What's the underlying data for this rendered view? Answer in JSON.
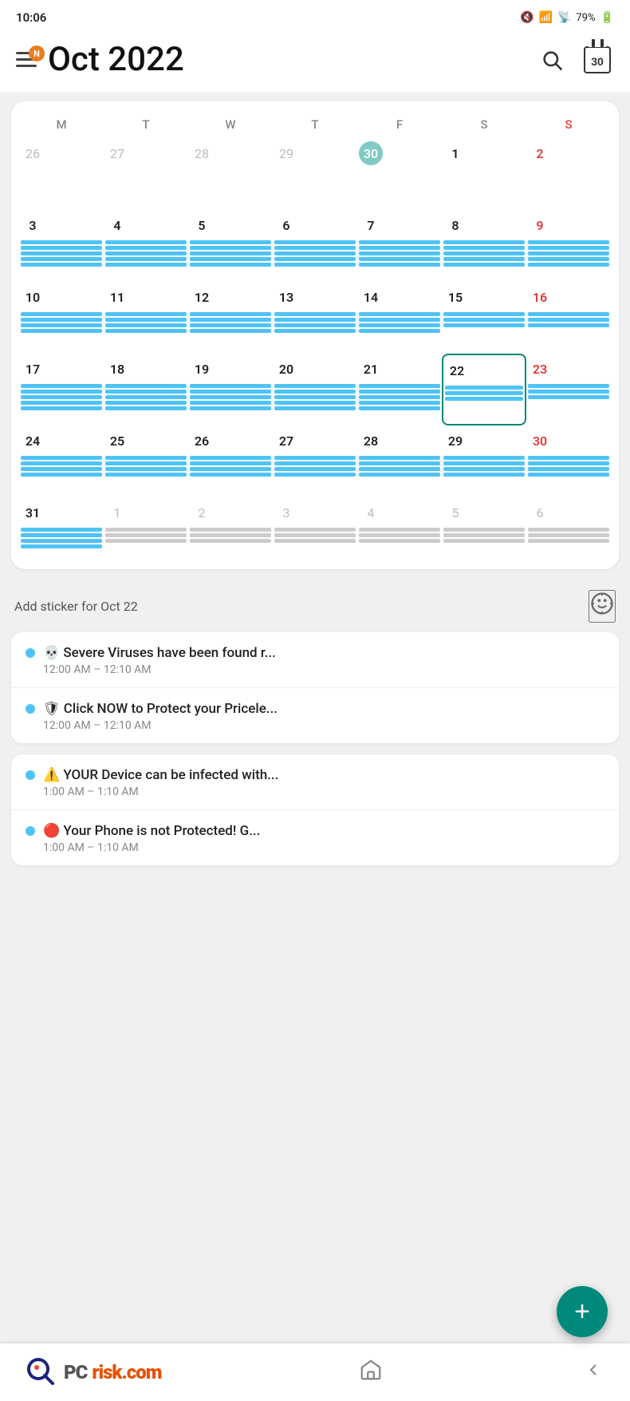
{
  "statusBar": {
    "time": "10:06",
    "battery": "79%"
  },
  "header": {
    "notification_badge": "N",
    "title": "Oct  2022",
    "search_label": "search",
    "calendar_label": "30"
  },
  "calendar": {
    "day_headers": [
      "M",
      "T",
      "W",
      "T",
      "F",
      "S",
      "S"
    ],
    "weeks": [
      [
        {
          "num": "26",
          "type": "grey",
          "lines": 0
        },
        {
          "num": "27",
          "type": "grey",
          "lines": 0
        },
        {
          "num": "28",
          "type": "grey",
          "lines": 0
        },
        {
          "num": "29",
          "type": "grey",
          "lines": 0
        },
        {
          "num": "30",
          "type": "today",
          "lines": 0
        },
        {
          "num": "1",
          "type": "normal",
          "lines": 0
        },
        {
          "num": "2",
          "type": "red",
          "lines": 0
        }
      ],
      [
        {
          "num": "3",
          "type": "normal",
          "lines": 5
        },
        {
          "num": "4",
          "type": "normal",
          "lines": 5
        },
        {
          "num": "5",
          "type": "normal",
          "lines": 5
        },
        {
          "num": "6",
          "type": "normal",
          "lines": 5
        },
        {
          "num": "7",
          "type": "normal",
          "lines": 5
        },
        {
          "num": "8",
          "type": "normal",
          "lines": 5
        },
        {
          "num": "9",
          "type": "red",
          "lines": 5
        }
      ],
      [
        {
          "num": "10",
          "type": "normal",
          "lines": 4
        },
        {
          "num": "11",
          "type": "normal",
          "lines": 4
        },
        {
          "num": "12",
          "type": "normal",
          "lines": 4
        },
        {
          "num": "13",
          "type": "normal",
          "lines": 4
        },
        {
          "num": "14",
          "type": "normal",
          "lines": 4
        },
        {
          "num": "15",
          "type": "normal",
          "lines": 3
        },
        {
          "num": "16",
          "type": "red",
          "lines": 3
        }
      ],
      [
        {
          "num": "17",
          "type": "normal",
          "lines": 5
        },
        {
          "num": "18",
          "type": "normal",
          "lines": 5
        },
        {
          "num": "19",
          "type": "normal",
          "lines": 5
        },
        {
          "num": "20",
          "type": "normal",
          "lines": 5
        },
        {
          "num": "21",
          "type": "normal",
          "lines": 5
        },
        {
          "num": "22",
          "type": "selected",
          "lines": 3
        },
        {
          "num": "23",
          "type": "red",
          "lines": 3
        }
      ],
      [
        {
          "num": "24",
          "type": "normal",
          "lines": 4
        },
        {
          "num": "25",
          "type": "normal",
          "lines": 4
        },
        {
          "num": "26",
          "type": "normal",
          "lines": 4
        },
        {
          "num": "27",
          "type": "normal",
          "lines": 4
        },
        {
          "num": "28",
          "type": "normal",
          "lines": 4
        },
        {
          "num": "29",
          "type": "normal",
          "lines": 4
        },
        {
          "num": "30",
          "type": "red",
          "lines": 4
        }
      ],
      [
        {
          "num": "31",
          "type": "normal",
          "lines": 4
        },
        {
          "num": "1",
          "type": "grey",
          "lines": 3
        },
        {
          "num": "2",
          "type": "grey",
          "lines": 3
        },
        {
          "num": "3",
          "type": "grey",
          "lines": 3
        },
        {
          "num": "4",
          "type": "grey",
          "lines": 3
        },
        {
          "num": "5",
          "type": "grey",
          "lines": 3
        },
        {
          "num": "6",
          "type": "grey",
          "lines": 3
        }
      ]
    ]
  },
  "sticker_row": {
    "text": "Add sticker for Oct 22",
    "icon": "sticker-icon"
  },
  "events": {
    "groups": [
      {
        "items": [
          {
            "title": "💀 Severe Viruses have been found r...",
            "time": "12:00 AM – 12:10 AM"
          },
          {
            "title": "🛡 Click NOW to Protect your Pricele...",
            "time": "12:00 AM – 12:10 AM"
          }
        ]
      },
      {
        "items": [
          {
            "title": "⚠️ YOUR Device can be infected with...",
            "time": "1:00 AM – 1:10 AM"
          },
          {
            "title": "🔴 Your Phone is not Protected! G...",
            "time": "1:00 AM – 1:10 AM"
          }
        ]
      }
    ]
  },
  "fab": {
    "label": "+"
  },
  "bottomBar": {
    "logo_text_1": "PC",
    "logo_text_2": "risk.com",
    "search_icon": "search",
    "back_icon": "back"
  }
}
